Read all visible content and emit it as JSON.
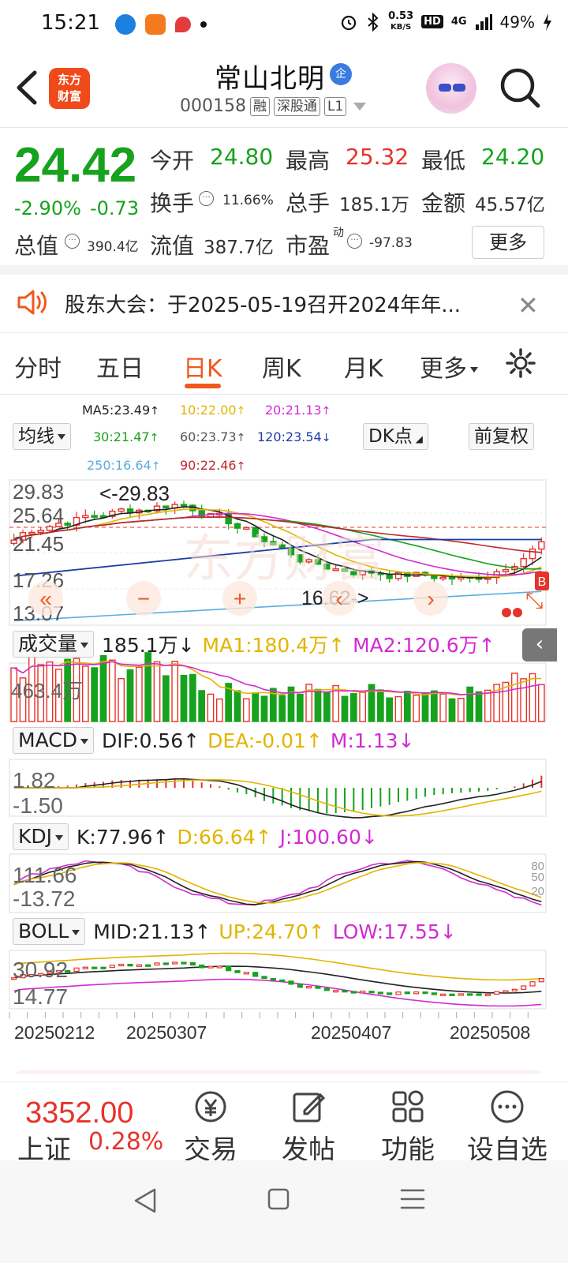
{
  "status_bar": {
    "time": "15:21",
    "net_speed_value": "0.53",
    "net_speed_unit": "KB/S",
    "hd": "HD",
    "network": "4G",
    "battery": "49%"
  },
  "header": {
    "logo_line1": "东方",
    "logo_line2": "财富",
    "stock_name": "常山北明",
    "qi_badge": "企",
    "stock_code": "000158",
    "tags": [
      "融",
      "深股通",
      "L1"
    ]
  },
  "quote": {
    "price": "24.42",
    "change_pct": "-2.90%",
    "change_amt": "-0.73",
    "open_label": "今开",
    "open": "24.80",
    "high_label": "最高",
    "high": "25.32",
    "low_label": "最低",
    "low": "24.20",
    "turnover_label": "换手",
    "turnover": "11.66%",
    "volume_label": "总手",
    "volume": "185.1万",
    "amount_label": "金额",
    "amount": "45.57亿",
    "mktcap_label": "总值",
    "mktcap": "390.4亿",
    "float_label": "流值",
    "float": "387.7亿",
    "pe_label": "市盈",
    "pe_sup": "动",
    "pe": "-97.83",
    "more_label": "更多"
  },
  "notice": {
    "text": "股东大会：于2025-05-19召开2024年年..."
  },
  "tabs": [
    "分时",
    "五日",
    "日K",
    "周K",
    "月K",
    "更多"
  ],
  "ma": {
    "selector": "均线",
    "dk_points": "DK点",
    "adjust": "前复权",
    "items": [
      {
        "text": "MA5:23.49",
        "arrow": "↑",
        "color": "#222222"
      },
      {
        "text": "10:22.00",
        "arrow": "↑",
        "color": "#e2b400"
      },
      {
        "text": "20:21.13",
        "arrow": "↑",
        "color": "#d22bd2"
      },
      {
        "text": "30:21.47",
        "arrow": "↑",
        "color": "#17a21e"
      },
      {
        "text": "60:23.73",
        "arrow": "↑",
        "color": "#555555"
      },
      {
        "text": "120:23.54",
        "arrow": "↓",
        "color": "#1a3da8"
      },
      {
        "text": "250:16.64",
        "arrow": "↑",
        "color": "#5aaee0"
      },
      {
        "text": "90:22.46",
        "arrow": "↑",
        "color": "#c0282d"
      }
    ]
  },
  "kline": {
    "y_labels": [
      "29.83",
      "25.64",
      "21.45",
      "17.26",
      "13.07"
    ],
    "high_marker": "29.83",
    "low_marker": "16.62->",
    "last_price_tag": "B",
    "x_labels": [
      "20250212",
      "20250307",
      "20250407",
      "20250508"
    ]
  },
  "volume_panel": {
    "selector": "成交量",
    "value": "185.1万",
    "value_arrow": "↓",
    "ma1": "MA1:180.4万",
    "ma1_arrow": "↑",
    "ma2": "MA2:120.6万",
    "ma2_arrow": "↑",
    "y_label": "463.4万"
  },
  "macd_panel": {
    "selector": "MACD",
    "dif": "DIF:0.56",
    "dif_arrow": "↑",
    "dea": "DEA:-0.01",
    "dea_arrow": "↑",
    "m": "M:1.13",
    "m_arrow": "↓",
    "y_labels": [
      "1.82",
      "-1.50"
    ]
  },
  "kdj_panel": {
    "selector": "KDJ",
    "k": "K:77.96",
    "k_arrow": "↑",
    "d": "D:66.64",
    "d_arrow": "↑",
    "j": "J:100.60",
    "j_arrow": "↓",
    "y_labels": [
      "111.66",
      "-13.72"
    ],
    "right_labels": [
      "80",
      "50",
      "20"
    ]
  },
  "boll_panel": {
    "selector": "BOLL",
    "mid": "MID:21.13",
    "mid_arrow": "↑",
    "up": "UP:24.70",
    "up_arrow": "↑",
    "low": "LOW:17.55",
    "low_arrow": "↓",
    "y_labels": [
      "30.92",
      "14.77"
    ]
  },
  "bottom_nav": {
    "index_price": "3352.00",
    "index_name": "上证",
    "index_pct": "0.28%",
    "items": [
      "交易",
      "发帖",
      "功能",
      "设自选"
    ]
  },
  "colors": {
    "up": "#e6332a",
    "down": "#17a21e",
    "accent": "#f0581c"
  }
}
